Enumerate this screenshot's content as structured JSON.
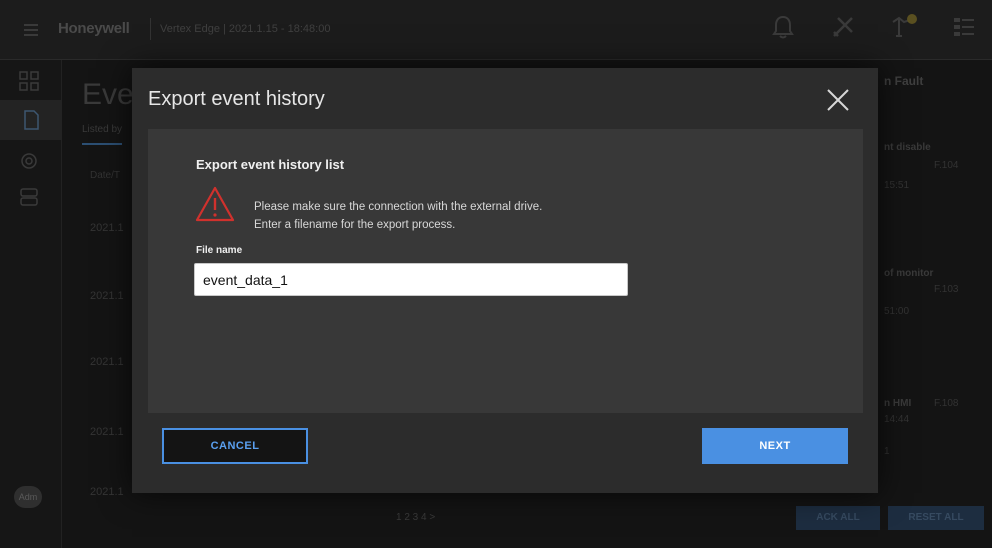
{
  "topbar": {
    "brand": "Honeywell",
    "device": "Vertex Edge | 2021.1.15 - 18:48:00",
    "icons": [
      "menu-icon",
      "bell-icon",
      "tools-icon",
      "alert-device-icon",
      "event-list-icon"
    ]
  },
  "leftnav": {
    "items": [
      "grid-icon",
      "document-icon",
      "settings-icon",
      "device-icon"
    ],
    "user_badge": "Adm"
  },
  "background": {
    "title": "Eve",
    "tab": "Listed by",
    "column": "Date/T",
    "rows": [
      "2021.1",
      "2021.1",
      "2021.1",
      "2021.1",
      "2021.1"
    ],
    "panel_title": "n Fault",
    "cards": [
      {
        "title": "nt disable",
        "code": "F.104",
        "time": "15:51"
      },
      {
        "title": "of monitor",
        "code": "F.103",
        "time": "51:00"
      },
      {
        "title": "n HMI",
        "code": "F.108",
        "time": "14:44"
      }
    ],
    "page_marker": "1",
    "ack_all": "ACK ALL",
    "reset_all": "RESET ALL",
    "pager": "1 2 3 4 >"
  },
  "modal": {
    "title": "Export event history",
    "heading": "Export event history list",
    "warning_lines": [
      "Please make sure the connection with the external drive.",
      "Enter a filename for the export process."
    ],
    "file_label": "File name",
    "file_value": "event_data_1",
    "cancel_label": "CANCEL",
    "next_label": "NEXT"
  },
  "colors": {
    "accent": "#4a90e2",
    "warning": "#d0312d",
    "modal_bg": "#2c2c2c",
    "modal_body_bg": "#383838"
  }
}
